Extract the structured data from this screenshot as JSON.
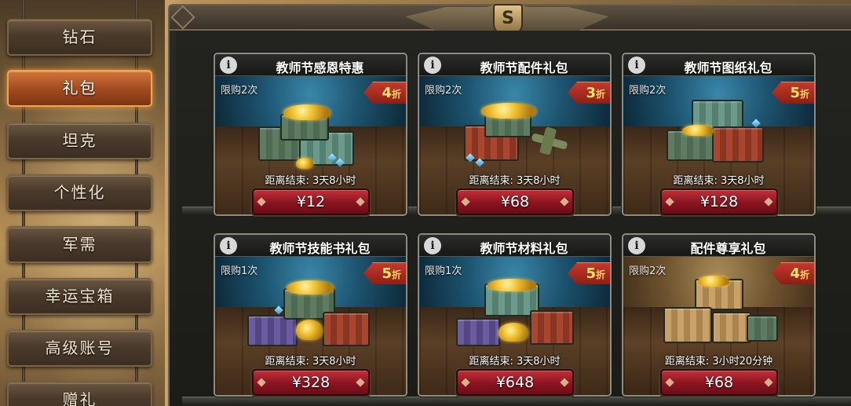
{
  "sidebar": {
    "items": [
      {
        "label": "钻石",
        "active": false
      },
      {
        "label": "礼包",
        "active": true
      },
      {
        "label": "坦克",
        "active": false
      },
      {
        "label": "个性化",
        "active": false
      },
      {
        "label": "军需",
        "active": false
      },
      {
        "label": "幸运宝箱",
        "active": false
      },
      {
        "label": "高级账号",
        "active": false
      },
      {
        "label": "赠礼",
        "active": false
      }
    ]
  },
  "header": {
    "emblem_glyph": "S"
  },
  "shop": {
    "discount_suffix": "折",
    "packs": [
      {
        "title": "教师节感恩特惠",
        "limit": "限购2次",
        "discount": "4",
        "countdown": "距离结束: 3天8小时",
        "price": "¥12",
        "theme": "blue"
      },
      {
        "title": "教师节配件礼包",
        "limit": "限购2次",
        "discount": "3",
        "countdown": "距离结束: 3天8小时",
        "price": "¥68",
        "theme": "blue"
      },
      {
        "title": "教师节图纸礼包",
        "limit": "限购2次",
        "discount": "5",
        "countdown": "距离结束: 3天8小时",
        "price": "¥128",
        "theme": "blue"
      },
      {
        "title": "教师节技能书礼包",
        "limit": "限购1次",
        "discount": "5",
        "countdown": "距离结束: 3天8小时",
        "price": "¥328",
        "theme": "blue"
      },
      {
        "title": "教师节材料礼包",
        "limit": "限购1次",
        "discount": "5",
        "countdown": "距离结束: 3天8小时",
        "price": "¥648",
        "theme": "blue"
      },
      {
        "title": "配件尊享礼包",
        "limit": "限购2次",
        "discount": "4",
        "countdown": "距离结束: 3小时20分钟",
        "price": "¥68",
        "theme": "gold"
      }
    ]
  },
  "colors": {
    "accent_active": "#d0763a",
    "price_red": "#8a1420",
    "discount_text": "#ffe26a"
  }
}
